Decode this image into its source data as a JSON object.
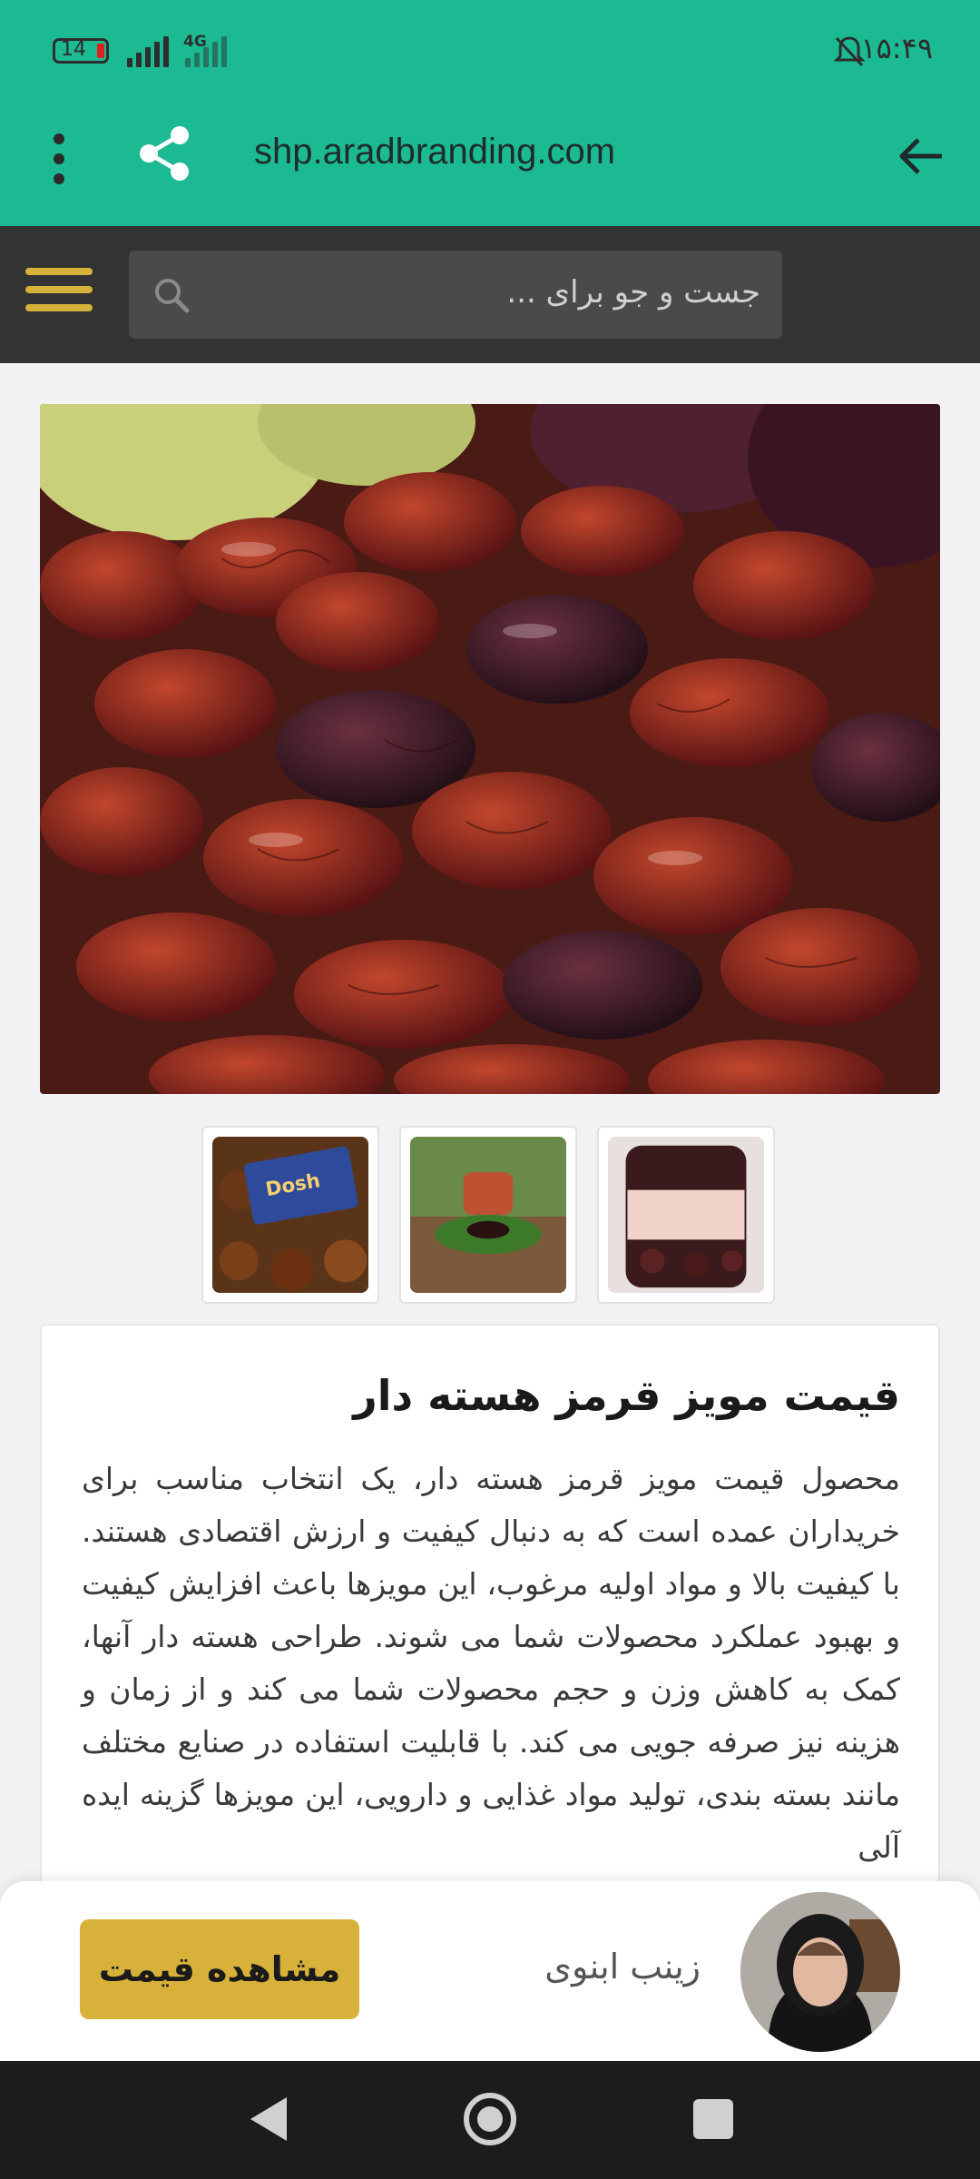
{
  "status_bar": {
    "battery": "14",
    "network": "4G",
    "time": "۱۵:۴۹"
  },
  "browser": {
    "url": "shp.aradbranding.com"
  },
  "search": {
    "placeholder": "جست و جو برای ..."
  },
  "product": {
    "title": "قیمت مویز قرمز هسته دار",
    "description": "محصول قیمت مویز قرمز هسته دار، یک انتخاب مناسب برای خریداران عمده است که به دنبال کیفیت و ارزش اقتصادی هستند. با کیفیت بالا و مواد اولیه مرغوب، این مویزها باعث افزایش کیفیت و بهبود عملکرد محصولات شما می شوند. طراحی هسته دار آنها، کمک به کاهش وزن و حجم محصولات شما می کند و از زمان و هزینه نیز صرفه جویی می کند. با قابلیت استفاده در صنایع مختلف مانند بسته بندی، تولید مواد غذایی و دارویی، این مویزها گزینه ایده آلی"
  },
  "cta": {
    "agent_name": "زینب ابنوی",
    "button_label": "مشاهده قیمت"
  },
  "icons": {
    "back": "back-arrow-icon",
    "share": "share-icon",
    "more": "more-vert-icon",
    "menu": "hamburger-menu-icon",
    "search": "search-icon",
    "mute": "bell-off-icon"
  },
  "colors": {
    "accent_green": "#1bba93",
    "header_dark": "#333333",
    "button_gold": "#d8b13a"
  }
}
